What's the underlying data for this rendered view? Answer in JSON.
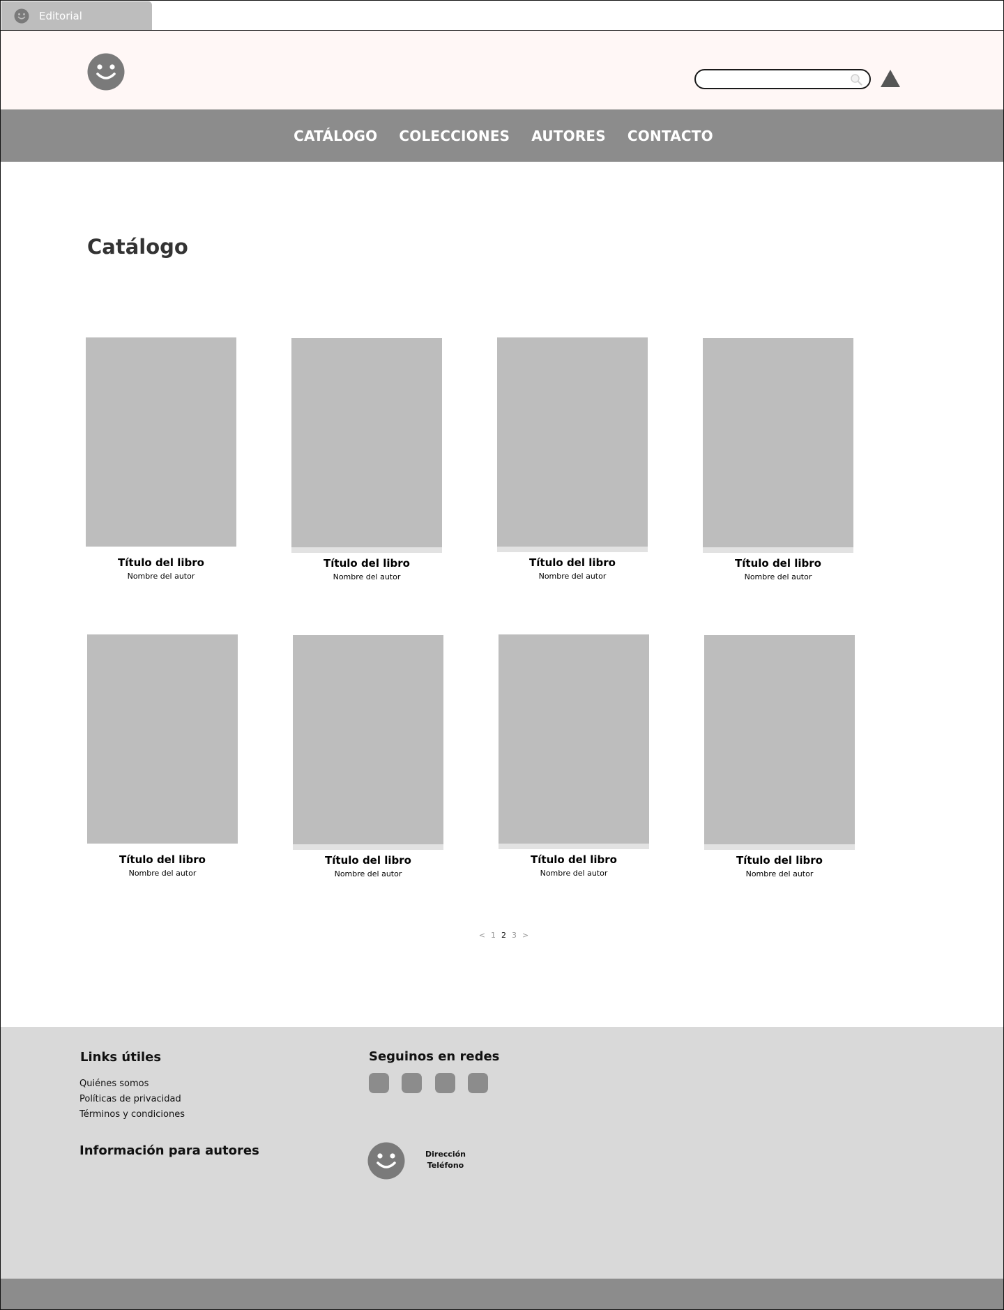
{
  "browser": {
    "tab_title": "Editorial"
  },
  "header": {
    "search_placeholder": ""
  },
  "nav": {
    "items": [
      "CATÁLOGO",
      "COLECCIONES",
      "AUTORES",
      "CONTACTO"
    ]
  },
  "main": {
    "title": "Catálogo",
    "books": [
      {
        "title": "Título del libro",
        "author": "Nombre del autor"
      },
      {
        "title": "Título del libro",
        "author": "Nombre del autor"
      },
      {
        "title": "Título del libro",
        "author": "Nombre del autor"
      },
      {
        "title": "Título del libro",
        "author": "Nombre del autor"
      },
      {
        "title": "Título del libro",
        "author": "Nombre del autor"
      },
      {
        "title": "Título del libro",
        "author": "Nombre del autor"
      },
      {
        "title": "Título del libro",
        "author": "Nombre del autor"
      },
      {
        "title": "Título del libro",
        "author": "Nombre del autor"
      }
    ],
    "pagination": {
      "prev": "<",
      "pages": [
        "1",
        "2",
        "3"
      ],
      "current": "2",
      "next": ">"
    }
  },
  "footer": {
    "links_heading": "Links útiles",
    "links": [
      "Quiénes somos",
      "Políticas de privacidad",
      "Términos y condiciones"
    ],
    "authors_heading": "Información para autores",
    "social_heading": "Seguinos en redes",
    "contact": {
      "address": "Dirección",
      "phone": "Teléfono"
    }
  },
  "colors": {
    "nav_bg": "#8c8c8c",
    "header_bg": "#fff7f6",
    "placeholder_gray": "#bdbdbd",
    "footer_bg": "#d9d9d9",
    "icon_gray": "#7a7a7a"
  }
}
